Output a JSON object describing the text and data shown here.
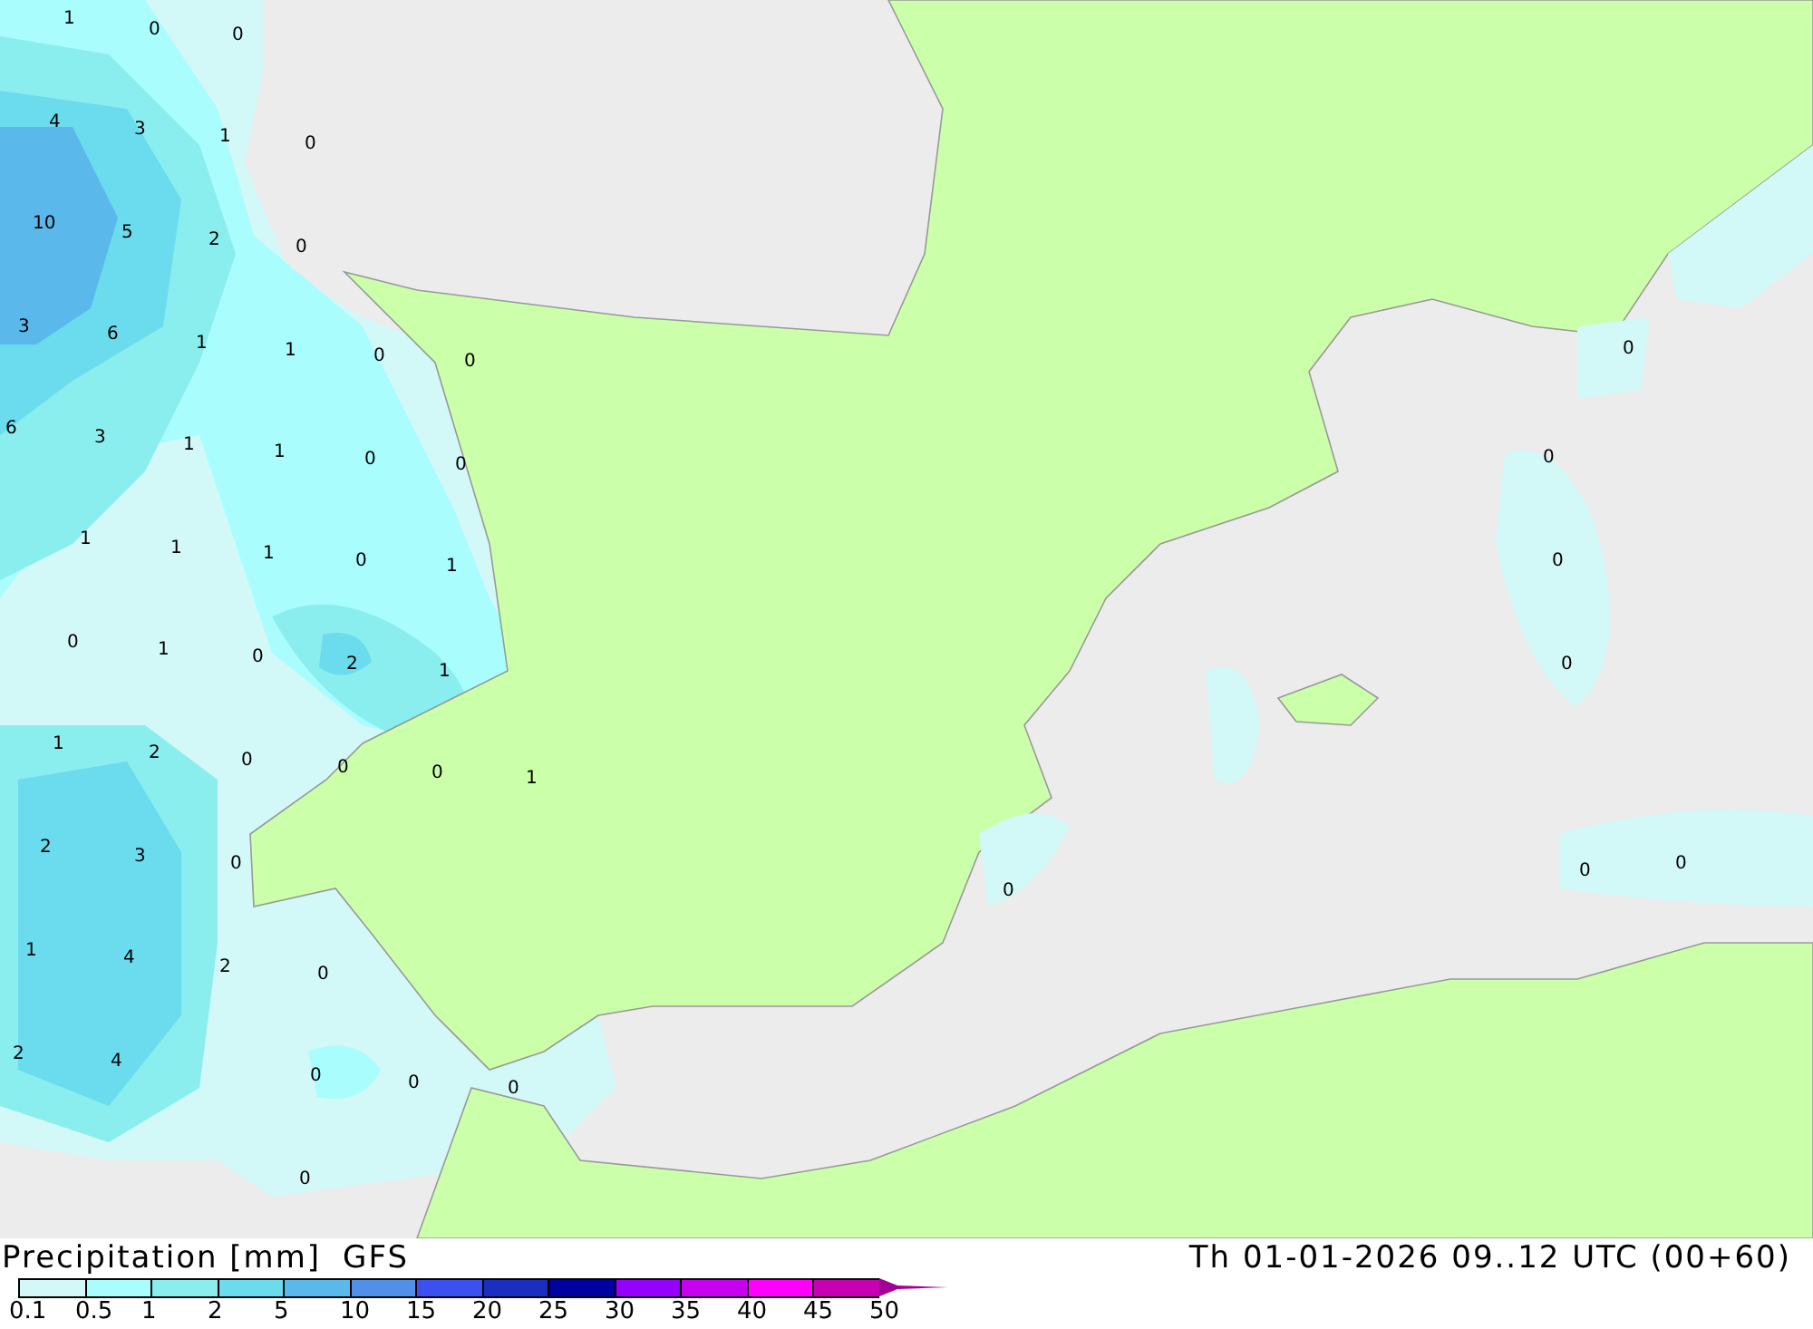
{
  "map": {
    "values": [
      "1",
      "0",
      "0",
      "4",
      "3",
      "1",
      "0",
      "10",
      "5",
      "2",
      "0",
      "3",
      "6",
      "1",
      "1",
      "0",
      "0",
      "6",
      "3",
      "1",
      "1",
      "0",
      "0",
      "1",
      "1",
      "1",
      "0",
      "1",
      "0",
      "1",
      "0",
      "2",
      "1",
      "1",
      "2",
      "0",
      "0",
      "0",
      "1",
      "2",
      "3",
      "0",
      "1",
      "4",
      "2",
      "0",
      "2",
      "4",
      "0",
      "0",
      "0",
      "0",
      "0",
      "0",
      "0",
      "0",
      "0",
      "0",
      "0"
    ]
  },
  "title": "Precipitation [mm]",
  "model": "GFS",
  "time": "Th 01-01-2026 09..12 UTC (00+60)",
  "legend": [
    {
      "label": "0.1",
      "color": "#d2f8f7"
    },
    {
      "label": "0.5",
      "color": "#a9fdfd"
    },
    {
      "label": "1",
      "color": "#8aeeee"
    },
    {
      "label": "2",
      "color": "#6adcee"
    },
    {
      "label": "5",
      "color": "#5ab8ea"
    },
    {
      "label": "10",
      "color": "#5090e8"
    },
    {
      "label": "15",
      "color": "#3c50f0"
    },
    {
      "label": "20",
      "color": "#1a2ec0"
    },
    {
      "label": "25",
      "color": "#0000a0"
    },
    {
      "label": "30",
      "color": "#9600ff"
    },
    {
      "label": "35",
      "color": "#c800f0"
    },
    {
      "label": "40",
      "color": "#ff00ff"
    },
    {
      "label": "45",
      "color": "#c800b4"
    }
  ],
  "legend_end": "50"
}
